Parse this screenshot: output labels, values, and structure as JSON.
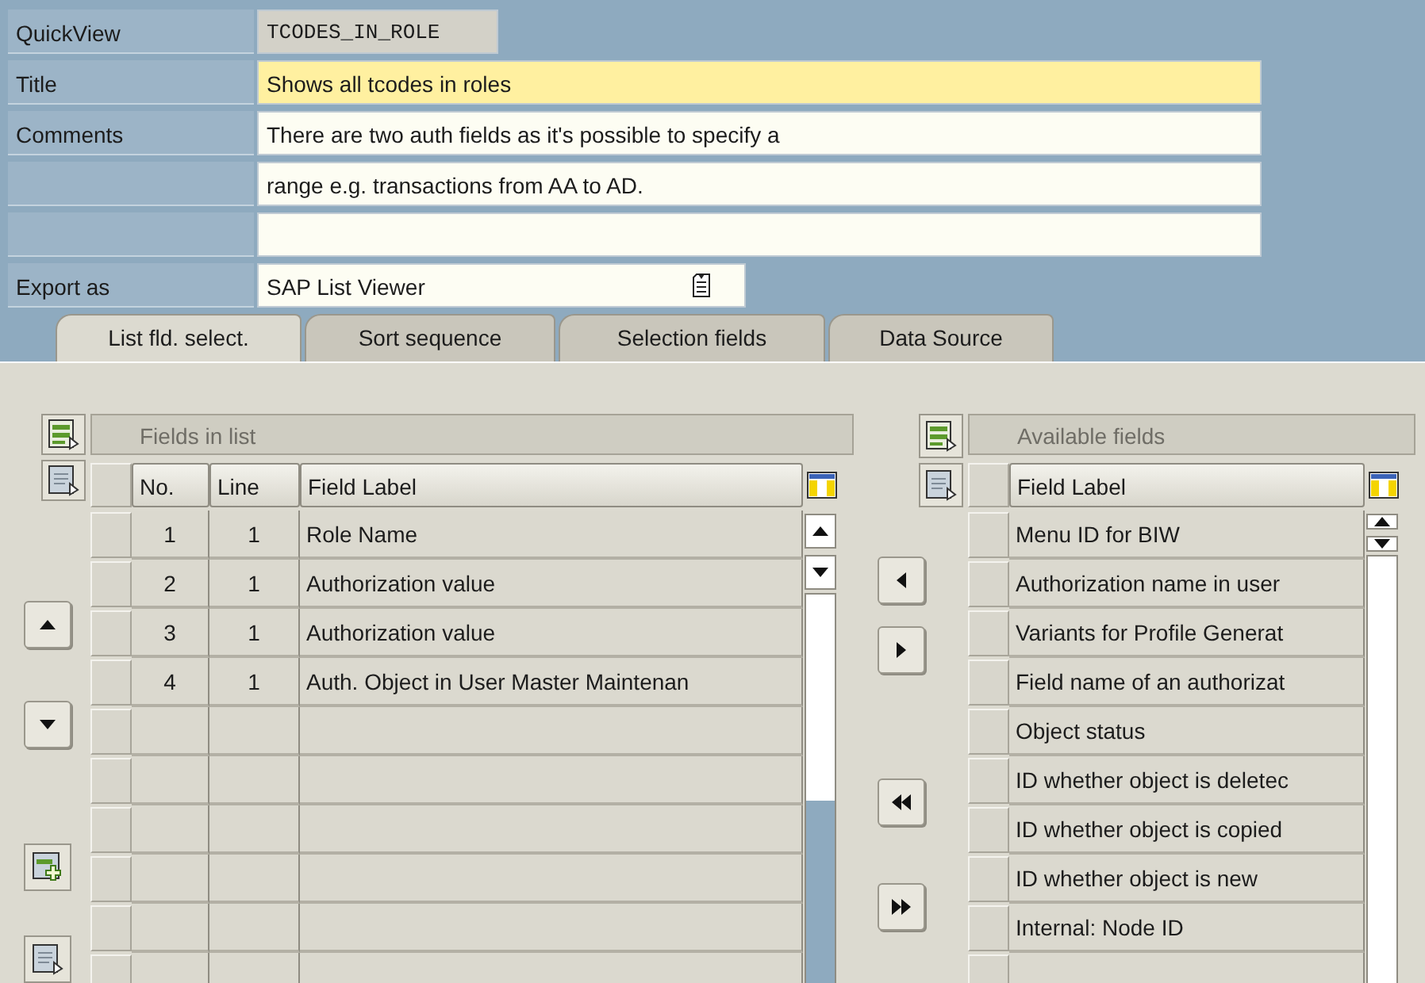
{
  "header_fields": [
    {
      "label": "QuickView",
      "kind": "readonly",
      "value": "TCODES_IN_ROLE"
    },
    {
      "label": "Title",
      "kind": "text",
      "focused": true,
      "value": "Shows all tcodes in roles"
    },
    {
      "label": "Comments",
      "kind": "text",
      "focused": false,
      "value": "There are two auth fields as it's possible to specify a"
    },
    {
      "kind": "text",
      "focused": false,
      "value": "range e.g. transactions from AA to AD."
    },
    {
      "kind": "text",
      "focused": false
    },
    {
      "label": "Export as",
      "kind": "dropdown",
      "value": "SAP List Viewer"
    }
  ],
  "tabs": [
    {
      "label": "List fld. select.",
      "selected": true
    },
    {
      "label": "Sort sequence",
      "selected": false
    },
    {
      "label": "Selection fields",
      "selected": false
    },
    {
      "label": "Data Source",
      "selected": false
    }
  ],
  "fields_in_list": {
    "title": "Fields in list",
    "columns": [
      "No.",
      "Line",
      "Field Label"
    ],
    "rows": [
      [
        "1",
        "1",
        "Role Name"
      ],
      [
        "2",
        "1",
        "Authorization value"
      ],
      [
        "3",
        "1",
        "Authorization value"
      ],
      [
        "4",
        "1",
        "Auth. Object in User Master Maintenan"
      ]
    ]
  },
  "available_fields": {
    "title": "Available fields",
    "columns": [
      "Field Label"
    ],
    "rows": [
      [
        "Menu ID for BIW"
      ],
      [
        "Authorization name in user"
      ],
      [
        "Variants for Profile Generat"
      ],
      [
        "Field name of an authorizat"
      ],
      [
        "Object status"
      ],
      [
        "ID whether object is deletec"
      ],
      [
        "ID whether object is copied"
      ],
      [
        "ID whether object is new"
      ],
      [
        "Internal: Node ID"
      ]
    ]
  }
}
